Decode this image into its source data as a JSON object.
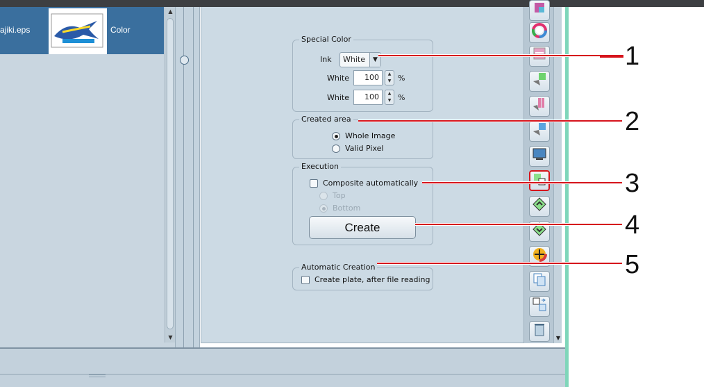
{
  "file_list": {
    "file_name": "ajiki.eps",
    "color_mode": "Color"
  },
  "special_color": {
    "legend": "Special Color",
    "ink_label": "Ink",
    "ink_value": "White",
    "rows": [
      {
        "label": "White",
        "value": "100",
        "unit": "%"
      },
      {
        "label": "White",
        "value": "100",
        "unit": "%"
      }
    ]
  },
  "created_area": {
    "legend": "Created area",
    "options": [
      "Whole Image",
      "Valid Pixel"
    ],
    "selected": "Whole Image"
  },
  "execution": {
    "legend": "Execution",
    "composite_label": "Composite automatically",
    "composite_checked": false,
    "position_options": [
      "Top",
      "Bottom"
    ],
    "position_selected": "Bottom",
    "create_label": "Create"
  },
  "automatic_creation": {
    "legend": "Automatic Creation",
    "checkbox_label": "Create plate, after file reading",
    "checked": false
  },
  "callouts": [
    "1",
    "2",
    "3",
    "4",
    "5"
  ],
  "colors": {
    "callout_red": "#d6141c",
    "panel_bg": "#ccdae4",
    "file_row_bg": "#3a6f9e"
  },
  "toolbar_icons": [
    "plate-icon",
    "color-wheel-q-icon",
    "layer-icon",
    "printer-green-icon",
    "printer-pink-icon",
    "printer-blue-icon",
    "monitor-icon",
    "create-plate-icon",
    "plate-up-icon",
    "plate-down-icon",
    "color-move-icon",
    "copy-icon",
    "swap-icon",
    "trash-icon"
  ]
}
